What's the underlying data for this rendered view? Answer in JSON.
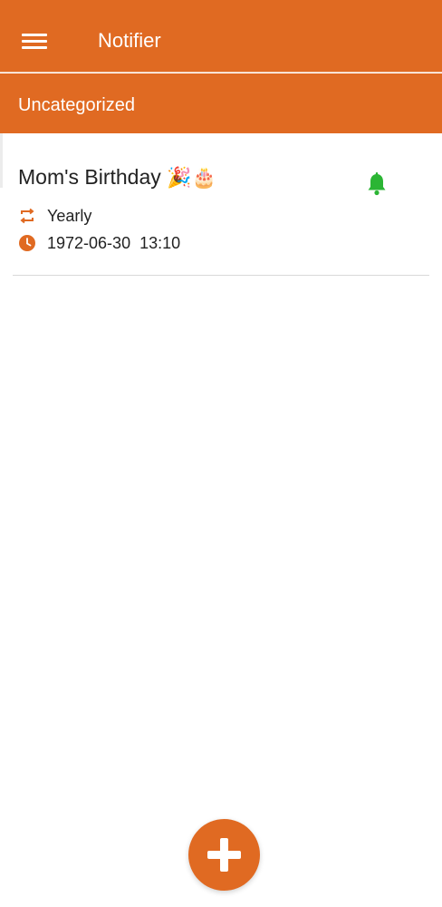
{
  "colors": {
    "accent": "#E06A22",
    "bell": "#2BB534",
    "text": "#222222",
    "divider": "#d8d8d8"
  },
  "toolbar": {
    "menu_icon": "hamburger-menu-icon",
    "title": "Notifier"
  },
  "category": {
    "title": "Uncategorized"
  },
  "reminders": [
    {
      "title": "Mom's Birthday",
      "emojis": "🎉🎂",
      "repeat_icon": "repeat-icon",
      "repeat": "Yearly",
      "time_icon": "clock-icon",
      "datetime": "1972-06-30  13:10",
      "bell_icon": "bell-icon"
    }
  ],
  "fab": {
    "icon": "plus-icon"
  }
}
